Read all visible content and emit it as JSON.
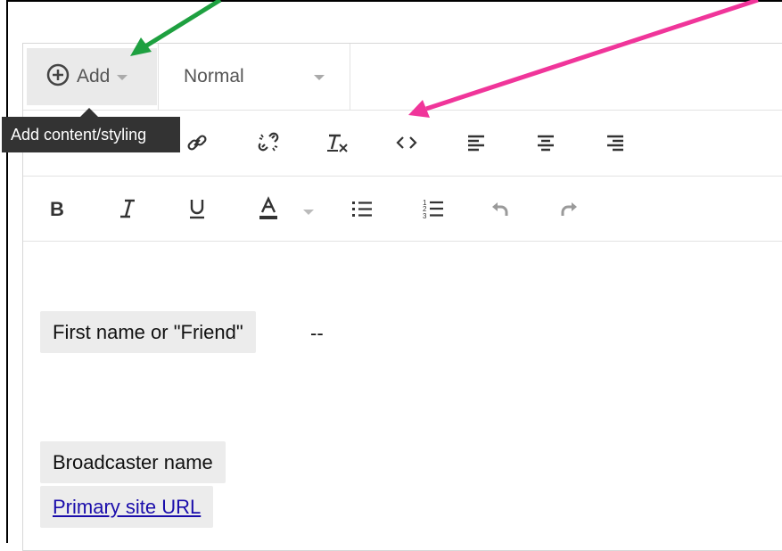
{
  "toolbar": {
    "add_label": "Add",
    "style_label": "Normal",
    "tooltip": "Add content/styling"
  },
  "icons": {
    "row2": [
      "link-icon",
      "unlink-icon",
      "clear-format-icon",
      "code-icon",
      "align-left-icon",
      "align-center-icon",
      "align-right-icon"
    ],
    "row3": [
      "bold-icon",
      "italic-icon",
      "underline-icon",
      "text-color-icon",
      "bullet-list-icon",
      "numbered-list-icon",
      "undo-icon",
      "redo-icon"
    ]
  },
  "content": {
    "chip_first_name": "First name or \"Friend\"",
    "dash": "--",
    "chip_broadcaster": "Broadcaster name",
    "chip_site_url": "Primary site URL"
  },
  "colors": {
    "arrow_green": "#1ea040",
    "arrow_pink": "#f0359a"
  }
}
